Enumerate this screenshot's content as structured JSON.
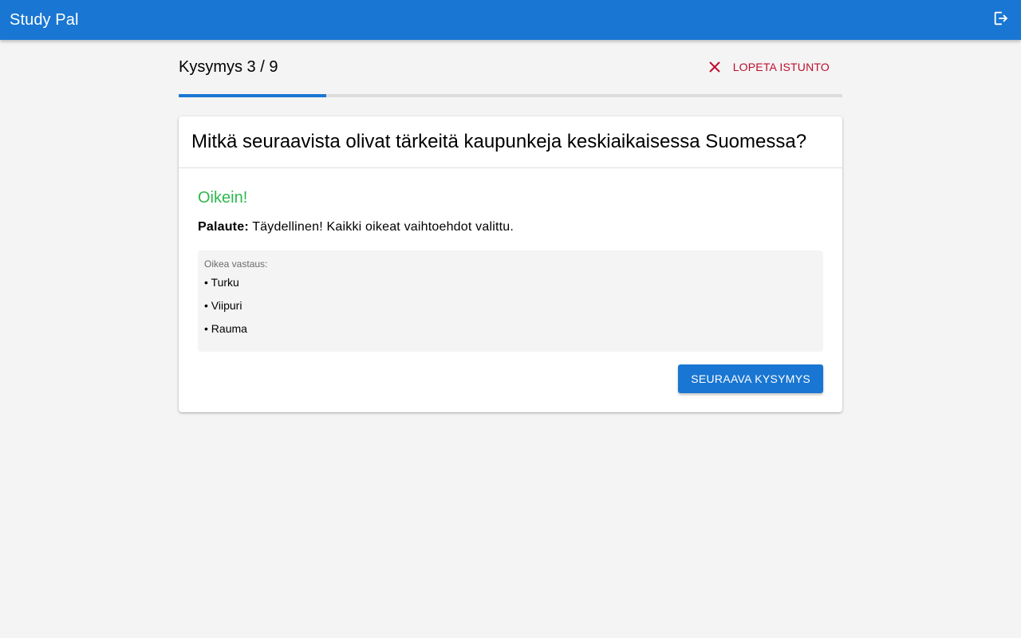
{
  "app": {
    "title": "Study Pal"
  },
  "icons": {
    "logout": "logout-icon",
    "close": "close-icon"
  },
  "colors": {
    "primary": "#1976d2",
    "danger": "#c00d2e",
    "success": "#2eb84f",
    "background": "#f4f4f4"
  },
  "session": {
    "counter": "Kysymys 3 / 9",
    "current": 3,
    "total": 9,
    "end_label": "LOPETA ISTUNTO",
    "progress_fraction": 0.2222
  },
  "question": {
    "text": "Mitkä seuraavista olivat tärkeitä kaupunkeja keskiaikaisessa Suomessa?"
  },
  "result": {
    "title": "Oikein!",
    "feedback_label": "Palaute:",
    "feedback_text": "Täydellinen! Kaikki oikeat vaihtoehdot valittu."
  },
  "correct_answer": {
    "label": "Oikea vastaus:",
    "items": [
      "• Turku",
      "• Viipuri",
      "• Rauma"
    ]
  },
  "actions": {
    "next_label": "SEURAAVA KYSYMYS"
  }
}
